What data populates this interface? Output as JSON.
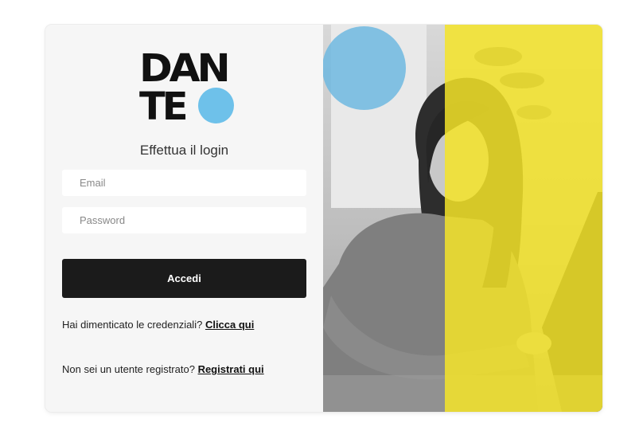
{
  "logo": {
    "line1": "DAN",
    "line2": "TE"
  },
  "form": {
    "title": "Effettua il login",
    "email_placeholder": "Email",
    "password_placeholder": "Password",
    "submit_label": "Accedi"
  },
  "help": {
    "forgot_text": "Hai dimenticato le credenziali?",
    "forgot_link": "Clicca qui",
    "register_text": "Non sei un utente registrato?",
    "register_link": "Registrati qui"
  },
  "colors": {
    "accent_blue": "#6ec1ea",
    "accent_yellow": "#f5e428",
    "button_bg": "#1b1b1b"
  },
  "icons": {
    "logo": "dante-logo-icon",
    "hero": "student-laptop-photo"
  }
}
